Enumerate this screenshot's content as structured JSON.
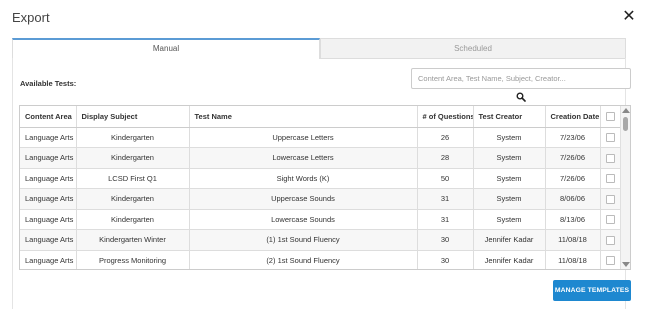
{
  "dialog": {
    "title": "Export",
    "close_glyph": "✕"
  },
  "tabs": [
    {
      "label": "Manual",
      "active": true
    },
    {
      "label": "Scheduled",
      "active": false
    }
  ],
  "available_label": "Available Tests:",
  "search": {
    "placeholder": "Content Area, Test Name, Subject, Creator...",
    "value": "",
    "icon": "search-icon"
  },
  "table": {
    "headers": [
      "Content Area",
      "Display Subject",
      "Test Name",
      "# of Questions",
      "Test Creator",
      "Creation Date"
    ],
    "rows": [
      {
        "area": "Language Arts",
        "subject": "Kindergarten",
        "name": "Uppercase Letters",
        "questions": "26",
        "creator": "System",
        "date": "7/23/06"
      },
      {
        "area": "Language Arts",
        "subject": "Kindergarten",
        "name": "Lowercase Letters",
        "questions": "28",
        "creator": "System",
        "date": "7/26/06"
      },
      {
        "area": "Language Arts",
        "subject": "LCSD First Q1",
        "name": "Sight Words (K)",
        "questions": "50",
        "creator": "System",
        "date": "7/26/06"
      },
      {
        "area": "Language Arts",
        "subject": "Kindergarten",
        "name": "Uppercase Sounds",
        "questions": "31",
        "creator": "System",
        "date": "8/06/06"
      },
      {
        "area": "Language Arts",
        "subject": "Kindergarten",
        "name": "Lowercase Sounds",
        "questions": "31",
        "creator": "System",
        "date": "8/13/06"
      },
      {
        "area": "Language Arts",
        "subject": "Kindergarten Winter",
        "name": "(1) 1st Sound Fluency",
        "questions": "30",
        "creator": "Jennifer Kadar",
        "date": "11/08/18"
      },
      {
        "area": "Language Arts",
        "subject": "Progress Monitoring",
        "name": "(2) 1st Sound Fluency",
        "questions": "30",
        "creator": "Jennifer Kadar",
        "date": "11/08/18"
      }
    ]
  },
  "footer": {
    "manage_label": "MANAGE TEMPLATES"
  },
  "colors": {
    "accent": "#1e88d0",
    "tab_border": "#5b9bd5"
  }
}
